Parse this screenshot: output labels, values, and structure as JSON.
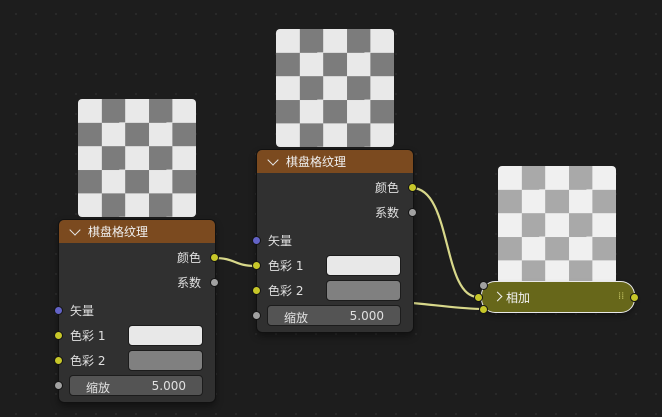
{
  "nodes": {
    "tex1": {
      "title": "棋盘格纹理",
      "outputs": {
        "color": "颜色",
        "fac": "系数"
      },
      "inputs": {
        "vector": "矢量",
        "color1": "色彩 1",
        "color2": "色彩 2"
      },
      "scale": {
        "label": "缩放",
        "value": "5.000"
      }
    },
    "tex2": {
      "title": "棋盘格纹理",
      "outputs": {
        "color": "颜色",
        "fac": "系数"
      },
      "inputs": {
        "vector": "矢量",
        "color1": "色彩 1",
        "color2": "色彩 2"
      },
      "scale": {
        "label": "缩放",
        "value": "5.000"
      }
    },
    "mix": {
      "title": "相加",
      "grip": "⁞⁞"
    }
  },
  "colors": {
    "background": "#1d1d1d",
    "node_body": "#303030",
    "texture_header": "#7b4a1f",
    "mix_node": "#67671a",
    "socket_color": "#c7c729",
    "socket_float": "#a1a1a1",
    "socket_vector": "#6363c7",
    "wire": "#d8d88a"
  },
  "icons": {
    "collapse": "chevron-down-icon",
    "mix_collapse": "chevron-right-icon",
    "mix_grip": "grip-icon"
  }
}
